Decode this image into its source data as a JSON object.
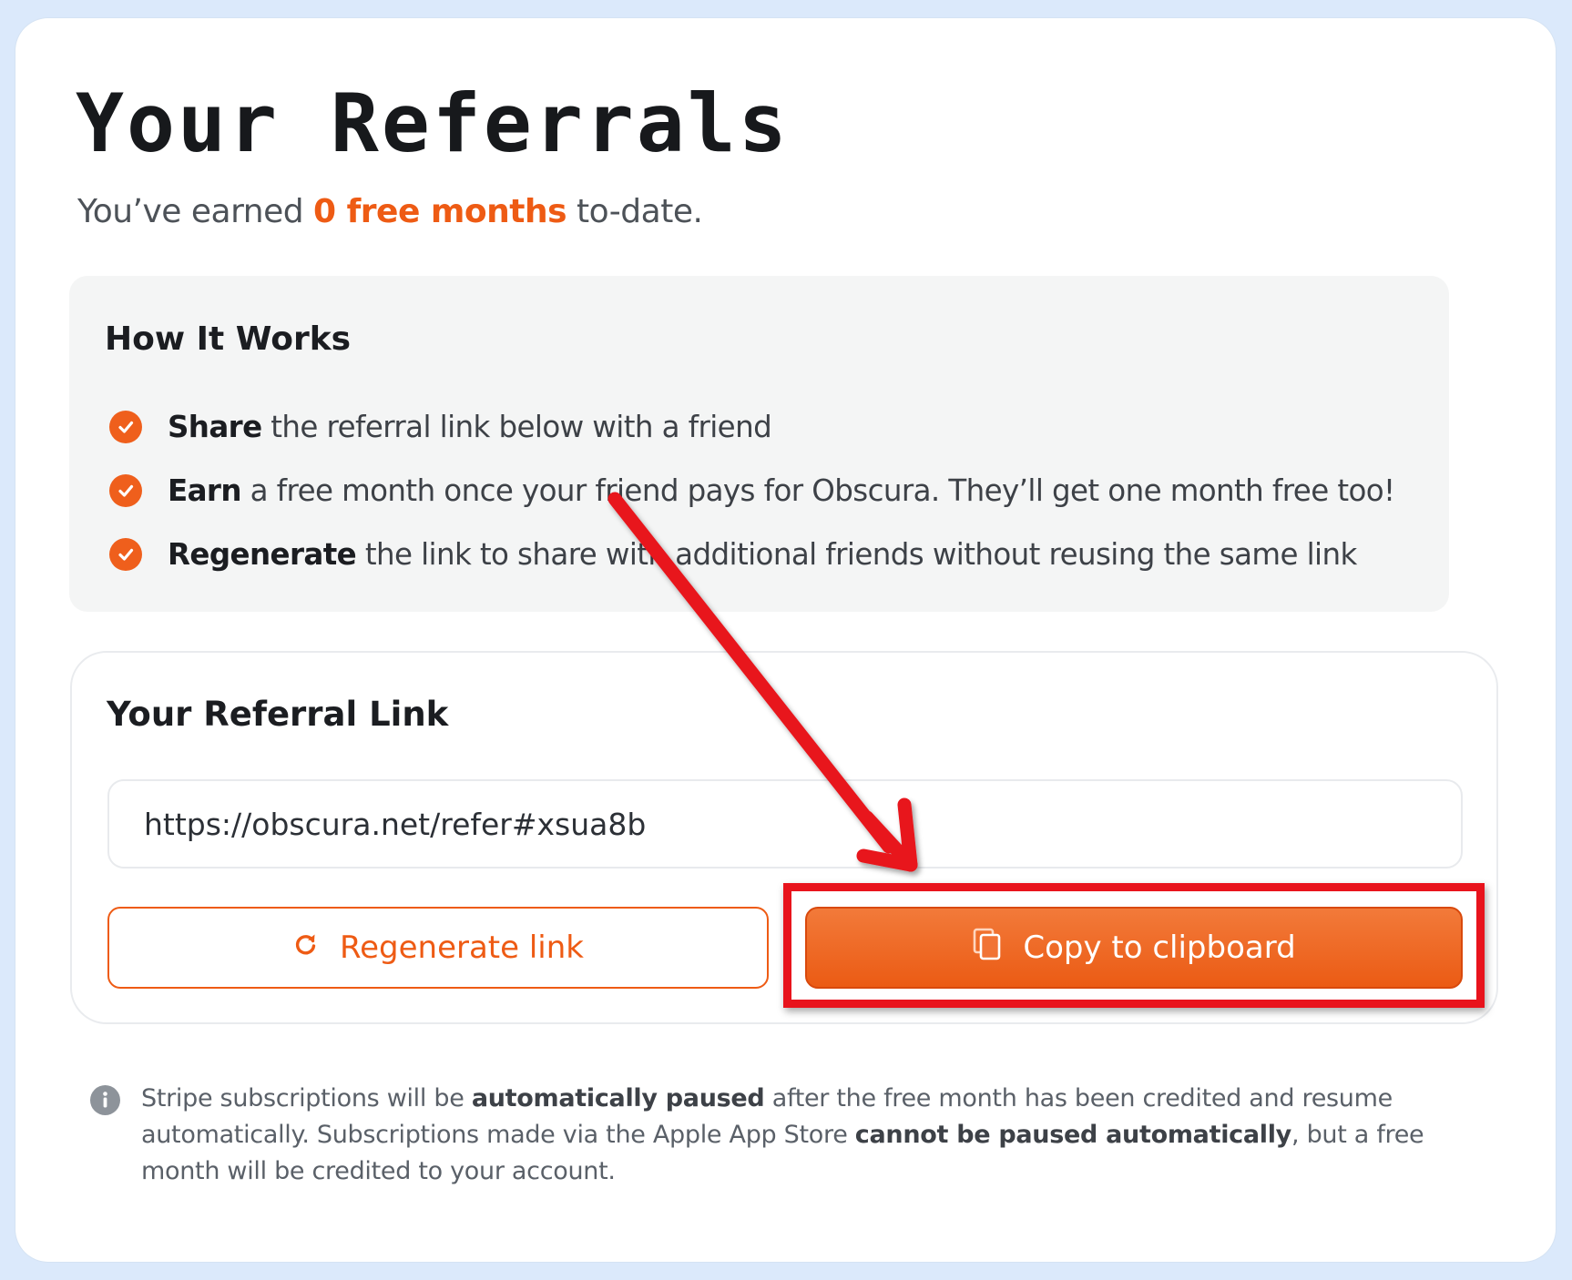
{
  "page": {
    "title": "Your Referrals",
    "earned_prefix": "You’ve earned ",
    "earned_highlight": "0 free months",
    "earned_suffix": " to-date."
  },
  "how_it_works": {
    "title": "How It Works",
    "steps": [
      {
        "bold": "Share",
        "text": " the referral link below with a friend"
      },
      {
        "bold": "Earn",
        "text": " a free month once your friend pays for Obscura. They’ll get one month free too!"
      },
      {
        "bold": "Regenerate",
        "text": " the link to share with additional friends without reusing the same link"
      }
    ]
  },
  "referral_link": {
    "title": "Your Referral Link",
    "url": "https://obscura.net/refer#xsua8b",
    "regenerate_label": "Regenerate link",
    "copy_label": "Copy to clipboard"
  },
  "note": {
    "part1": "Stripe subscriptions will be ",
    "bold1": "automatically paused",
    "part2": " after the free month has been credited and resume automatically. Subscriptions made via the Apple App Store ",
    "bold2": "cannot be paused automatically",
    "part3": ", but a free month will be credited to your account."
  },
  "colors": {
    "accent": "#ee5b14",
    "annotation": "#e8131c",
    "background": "#dbe9fb"
  },
  "icons": {
    "step": "check-circle-icon",
    "regenerate": "refresh-icon",
    "copy": "copy-icon",
    "note": "info-icon"
  }
}
